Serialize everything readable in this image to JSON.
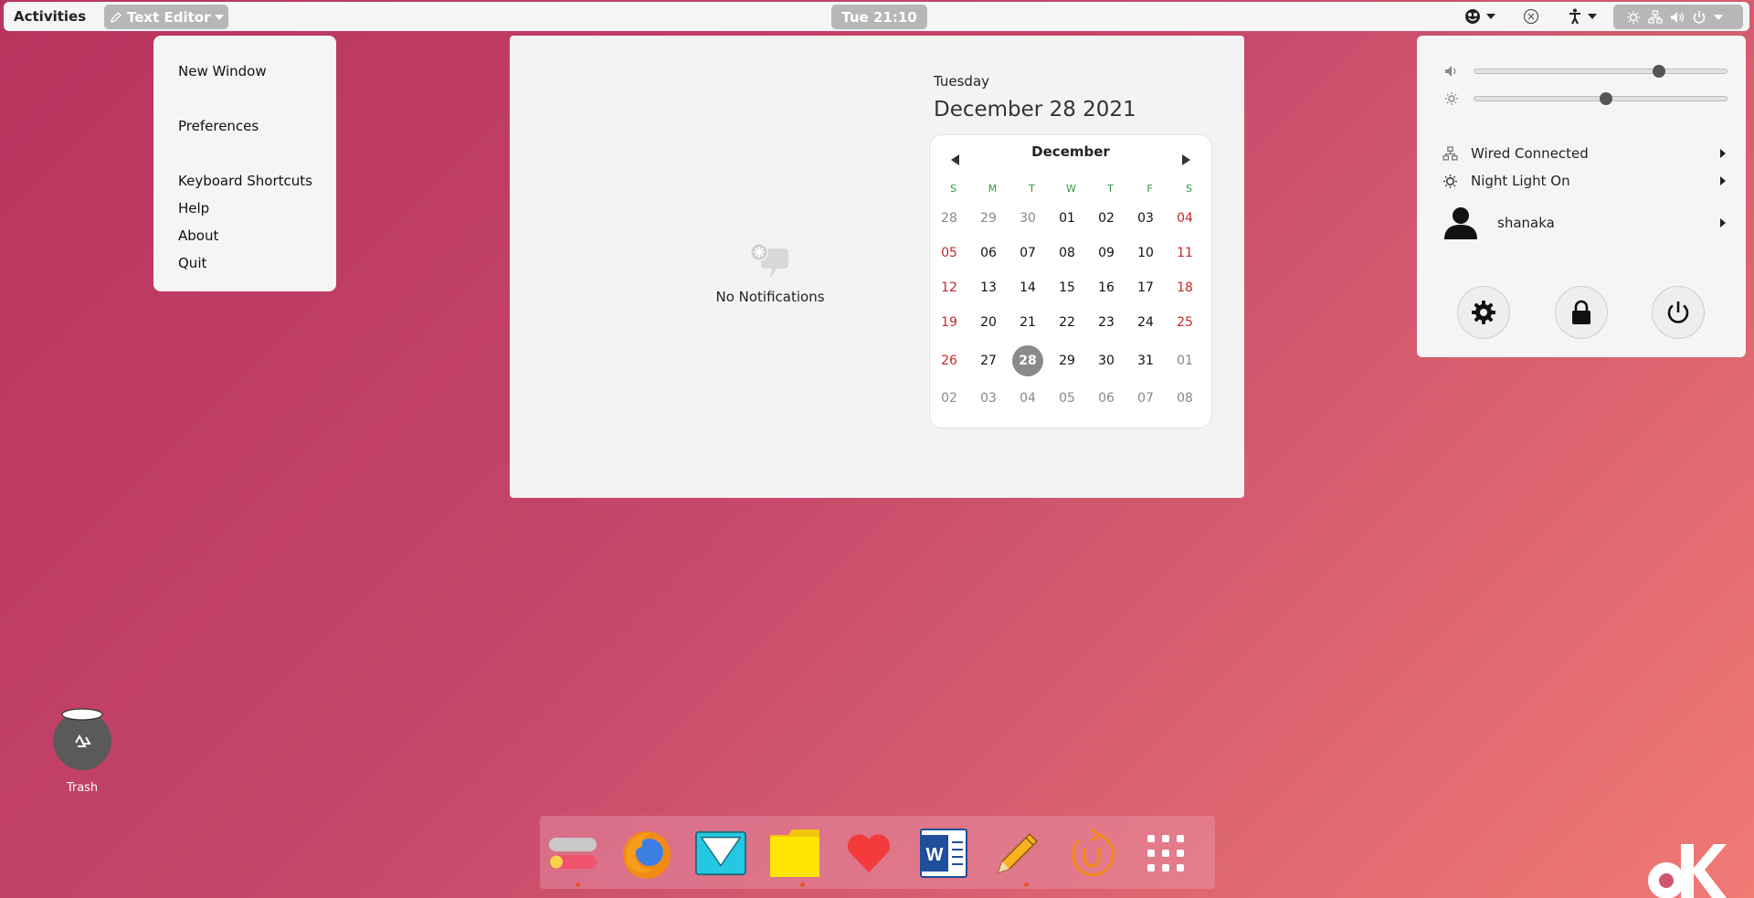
{
  "topbar": {
    "activities_label": "Activities",
    "app_menu_label": "Text Editor",
    "clock_label": "Tue 21:10"
  },
  "app_menu": {
    "items": [
      "New Window",
      "Preferences",
      "Keyboard Shortcuts",
      "Help",
      "About",
      "Quit"
    ]
  },
  "notifications": {
    "empty_label": "No Notifications"
  },
  "calendar": {
    "day_name": "Tuesday",
    "full_date": "December 28 2021",
    "month_label": "December",
    "weekdays": [
      "S",
      "M",
      "T",
      "W",
      "T",
      "F",
      "S"
    ],
    "weeks": [
      [
        "28",
        "29",
        "30",
        "01",
        "02",
        "03",
        "04"
      ],
      [
        "05",
        "06",
        "07",
        "08",
        "09",
        "10",
        "11"
      ],
      [
        "12",
        "13",
        "14",
        "15",
        "16",
        "17",
        "18"
      ],
      [
        "19",
        "20",
        "21",
        "22",
        "23",
        "24",
        "25"
      ],
      [
        "26",
        "27",
        "28",
        "29",
        "30",
        "31",
        "01"
      ],
      [
        "02",
        "03",
        "04",
        "05",
        "06",
        "07",
        "08"
      ]
    ],
    "today": "28"
  },
  "system_menu": {
    "volume_level": 0.73,
    "brightness_level": 0.52,
    "network_label": "Wired Connected",
    "night_light_label": "Night Light On",
    "user_label": "shanaka"
  },
  "desktop": {
    "trash_label": "Trash"
  },
  "dock": {
    "apps": [
      "settings-toggle",
      "firefox",
      "mail",
      "files",
      "favorites",
      "word",
      "text-editor",
      "software-updater",
      "app-grid"
    ]
  },
  "colors": {
    "accent_green": "#2a9a3a",
    "weekend_red": "#c62828",
    "today_bg": "#8a8a8a"
  }
}
